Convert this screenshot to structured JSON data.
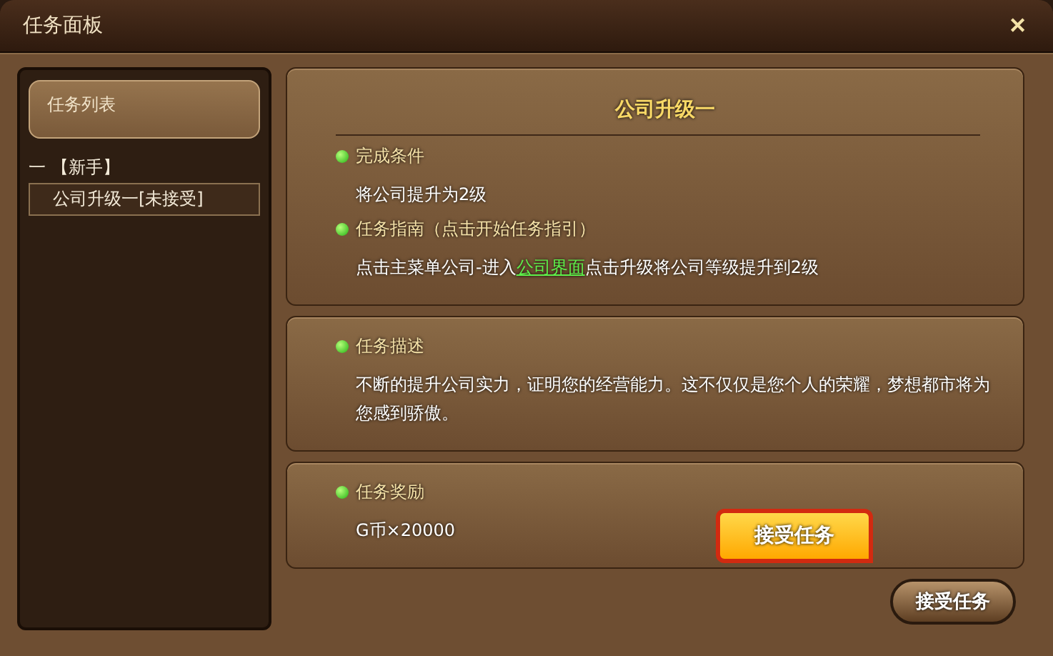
{
  "window": {
    "title": "任务面板",
    "close": "✕"
  },
  "sidebar": {
    "header": "任务列表",
    "groups": [
      {
        "marker": "一",
        "label": "【新手】",
        "expanded": true,
        "children": [
          {
            "label": "公司升级一[未接受]",
            "selected": true
          }
        ]
      }
    ]
  },
  "quest": {
    "title": "公司升级一",
    "cards": [
      {
        "sections": [
          {
            "heading": "完成条件",
            "body": [
              {
                "text": "将公司提升为2级",
                "kind": "plain"
              }
            ]
          },
          {
            "heading": "任务指南（点击开始任务指引）",
            "body": [
              {
                "text": "点击主菜单公司-进入",
                "kind": "plain"
              },
              {
                "text": "公司界面",
                "kind": "link"
              },
              {
                "text": "点击升级将公司等级提升到2级",
                "kind": "plain"
              }
            ]
          }
        ]
      },
      {
        "sections": [
          {
            "heading": "任务描述",
            "body": [
              {
                "text": "不断的提升公司实力，证明您的经营能力。这不仅仅是您个人的荣耀，梦想都市将为您感到骄傲。",
                "kind": "plain"
              }
            ]
          }
        ]
      },
      {
        "sections": [
          {
            "heading": "任务奖励",
            "body": [
              {
                "text": "G币×20000",
                "kind": "plain"
              }
            ]
          }
        ],
        "callout": "接受任务"
      }
    ]
  },
  "buttons": [
    "接受任务"
  ]
}
